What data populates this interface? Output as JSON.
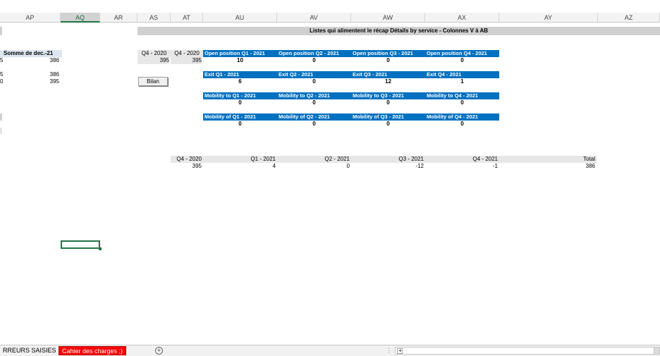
{
  "columns": [
    "AP",
    "AQ",
    "AR",
    "AS",
    "AT",
    "AU",
    "AV",
    "AW",
    "AX",
    "AY",
    "AZ"
  ],
  "selected_column": "AQ",
  "banner": {
    "title": "Listes qui alimentent le récap Détails by service - Colonnes V à AB"
  },
  "left_table": {
    "header": "Somme de dec.-21",
    "values": [
      "386",
      "386",
      "395"
    ],
    "cut_values": [
      "5",
      "5",
      "0"
    ]
  },
  "quarter_headers": {
    "as": "Q4 - 2020",
    "at": "Q4 - 2020",
    "as_value": "395",
    "at_value": "395"
  },
  "button": {
    "label": "Bilan"
  },
  "open_position": {
    "headers": [
      "Open position Q1 - 2021",
      "Open position Q2 - 2021",
      "Open position Q3 - 2021",
      "Open position Q4 - 2021"
    ],
    "values": [
      "10",
      "0",
      "0",
      "0"
    ]
  },
  "exit": {
    "headers": [
      "Exit Q1 - 2021",
      "Exit Q2 - 2021",
      "Exit Q3 - 2021",
      "Exit Q4 - 2021"
    ],
    "values": [
      "6",
      "0",
      "12",
      "1"
    ]
  },
  "mobility_to": {
    "headers": [
      "Mobility to Q1 - 2021",
      "Mobility to Q2 - 2021",
      "Mobility to Q3 - 2021",
      "Mobility to Q4 - 2021"
    ],
    "values": [
      "0",
      "0",
      "0",
      "0"
    ]
  },
  "mobility_of": {
    "headers": [
      "Mobility of Q1 - 2021",
      "Mobility of Q2 - 2021",
      "Mobility of Q3 - 2021",
      "Mobility of Q4 - 2021"
    ],
    "values": [
      "0",
      "0",
      "0",
      "0"
    ]
  },
  "summary": {
    "headers": [
      "Q4 - 2020",
      "Q1 - 2021",
      "Q2 - 2021",
      "Q3 - 2021",
      "Q4 - 2021",
      "Total"
    ],
    "values": [
      "395",
      "4",
      "0",
      "-12",
      "-1",
      "386"
    ]
  },
  "sheet_tabs": {
    "tab1": "RREURS SAISIES",
    "tab2": "Cahier des charges ;)",
    "add_icon": "+",
    "dots": "⋮",
    "scroll_left": "◄"
  },
  "colors": {
    "header_blue": "#0070c0",
    "tab_red": "#ff0000",
    "selection_green": "#217346"
  }
}
